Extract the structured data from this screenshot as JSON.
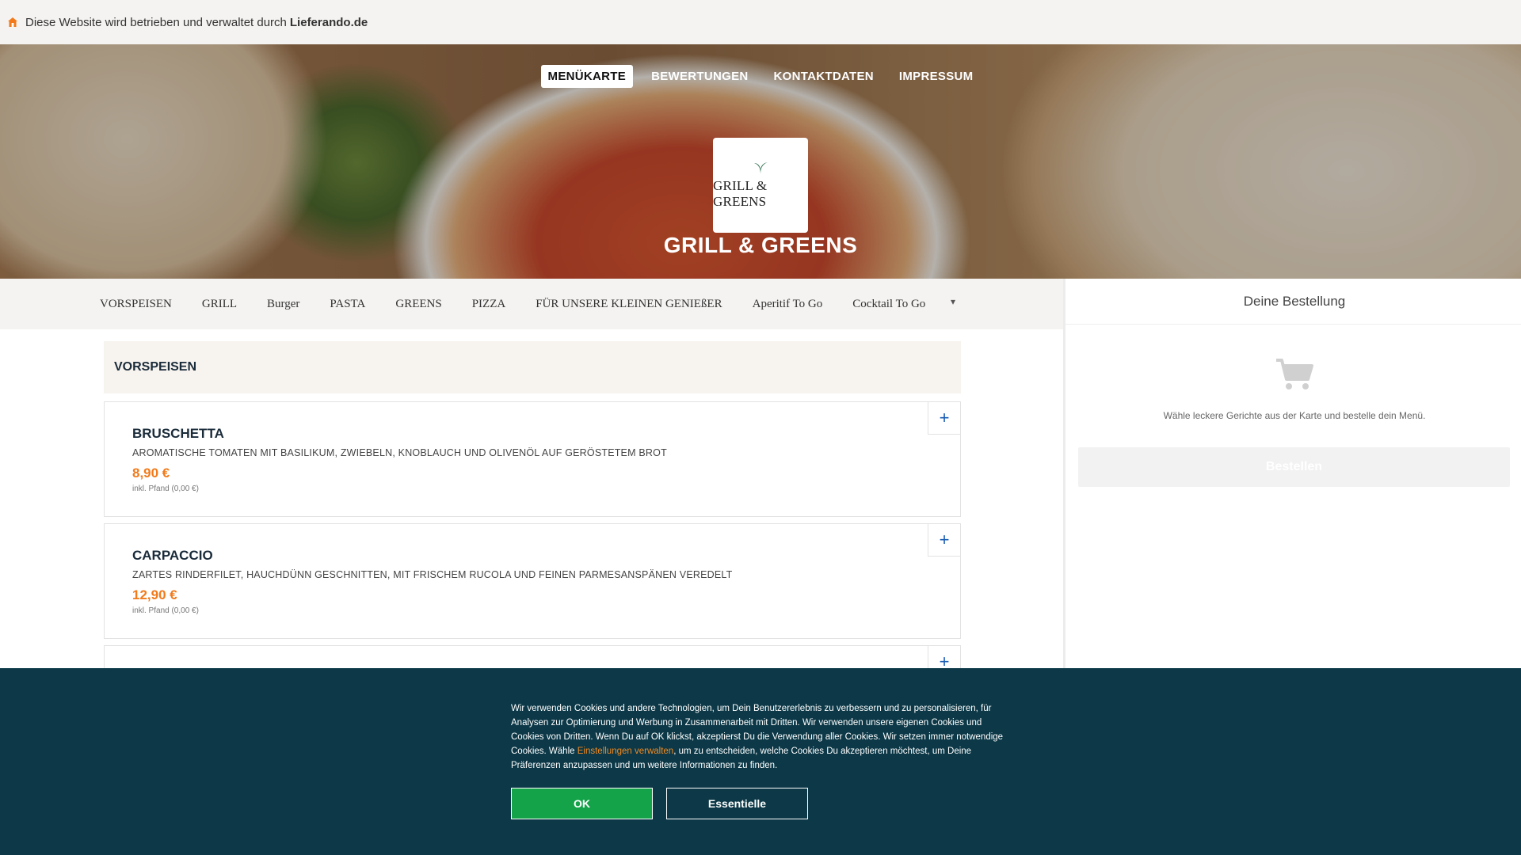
{
  "topbar": {
    "notice": "Diese Website wird betrieben und verwaltet durch",
    "brand": "Lieferando.de",
    "icon": "house-icon"
  },
  "nav": {
    "items": [
      "MENÜKARTE",
      "BEWERTUNGEN",
      "KONTAKTDATEN",
      "IMPRESSUM"
    ]
  },
  "restaurant": {
    "logo_text": "GRILL & GREENS",
    "name": "GRILL & GREENS"
  },
  "categories": [
    "VORSPEISEN",
    "GRILL",
    "Burger",
    "PASTA",
    "GREENS",
    "PIZZA",
    "FÜR UNSERE KLEINEN GENIEßER",
    "Aperitif To Go",
    "Cocktail To Go"
  ],
  "categories_more_icon": "chevron-down-icon",
  "section": {
    "title": "VORSPEISEN"
  },
  "items": [
    {
      "name": "BRUSCHETTA",
      "description": "AROMATISCHE TOMATEN MIT BASILIKUM, ZWIEBELN, KNOBLAUCH UND OLIVENÖL AUF GERÖSTETEM BROT",
      "price": "8,90 €",
      "pfand": "inkl. Pfand (0,00 €)",
      "add": "+"
    },
    {
      "name": "CARPACCIO",
      "description": "ZARTES RINDERFILET, HAUCHDÜNN GESCHNITTEN, MIT FRISCHEM RUCOLA UND FEINEN PARMESANSPÄNEN VEREDELT",
      "price": "12,90 €",
      "pfand": "inkl. Pfand (0,00 €)",
      "add": "+"
    },
    {
      "add": "+"
    }
  ],
  "order": {
    "title": "Deine Bestellung",
    "hint": "Wähle leckere Gerichte aus der Karte und bestelle dein Menü.",
    "button": "Bestellen",
    "icon": "cart-icon"
  },
  "cookie": {
    "text_before": "Wir verwenden Cookies und andere Technologien, um Dein Benutzererlebnis zu verbessern und zu personalisieren, für Analysen zur Optimierung und Werbung in Zusammenarbeit mit Dritten. Wir verwenden unsere eigenen Cookies und Cookies von Dritten. Wenn Du auf OK klickst, akzeptierst Du die Verwendung aller Cookies. Wir setzen immer notwendige Cookies. Wähle ",
    "link": "Einstellungen verwalten",
    "text_after": ", um zu entscheiden, welche Cookies Du akzeptieren möchtest, um Deine Präferenzen anzupassen und um weitere Informationen zu finden.",
    "ok": "OK",
    "essential": "Essentielle"
  },
  "colors": {
    "accent_orange": "#f27a1a",
    "cookie_bg": "#0c3847",
    "ok_green": "#15a34a",
    "heading_navy": "#1a2b3a"
  }
}
